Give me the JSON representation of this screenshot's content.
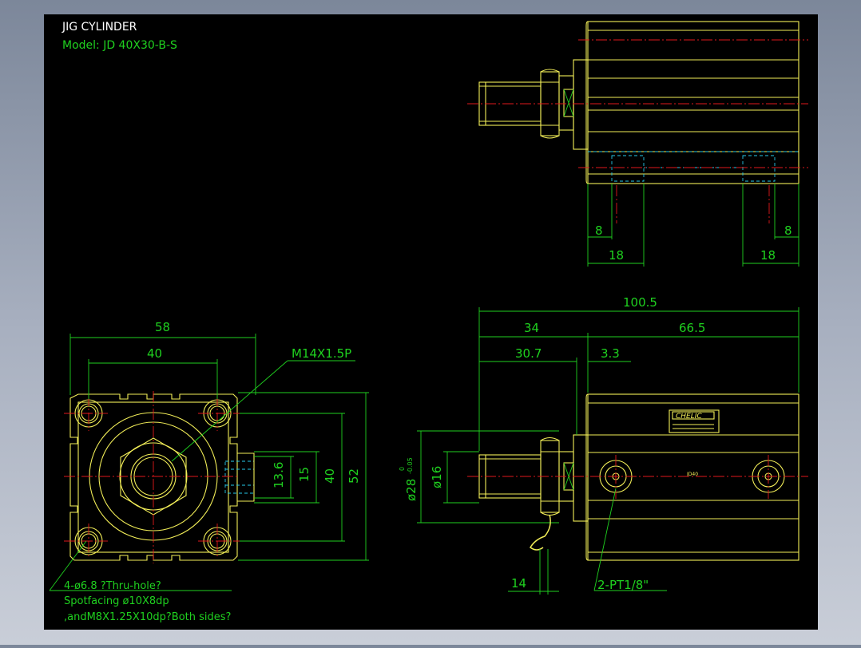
{
  "drawing": {
    "title": "JIG CYLINDER",
    "model": "Model: JD 40X30-B-S"
  },
  "dimensions": {
    "side_8_left": "8",
    "side_8_right": "8",
    "side_18_left": "18",
    "side_18_right": "18",
    "front_58": "58",
    "front_40_top": "40",
    "front_thread": "M14X1.5P",
    "front_13_6": "13.6",
    "front_15": "15",
    "front_40_vert": "40",
    "front_52": "52",
    "elev_100_5": "100.5",
    "elev_34": "34",
    "elev_66_5": "66.5",
    "elev_30_7": "30.7",
    "elev_3_3": "3.3",
    "elev_dia16": "ø16",
    "elev_dia28": "ø28",
    "elev_tol_upper": "0",
    "elev_tol_lower": "-0.05",
    "elev_14": "14",
    "elev_port": "2-PT1/8\""
  },
  "notes": {
    "line1": "4-ø6.8 ?Thru-hole?",
    "line2": "Spotfacing  ø10X8dp",
    "line3": ",andM8X1.25X10dp?Both sides?"
  },
  "label": {
    "brand": "CHELIC",
    "code": "JD40"
  },
  "colors": {
    "background": "#000000",
    "outline": "#f2ee58",
    "dimension": "#1fd11f",
    "centerline": "#e0191b",
    "hidden": "#26c7e8",
    "title": "#ffffff"
  }
}
